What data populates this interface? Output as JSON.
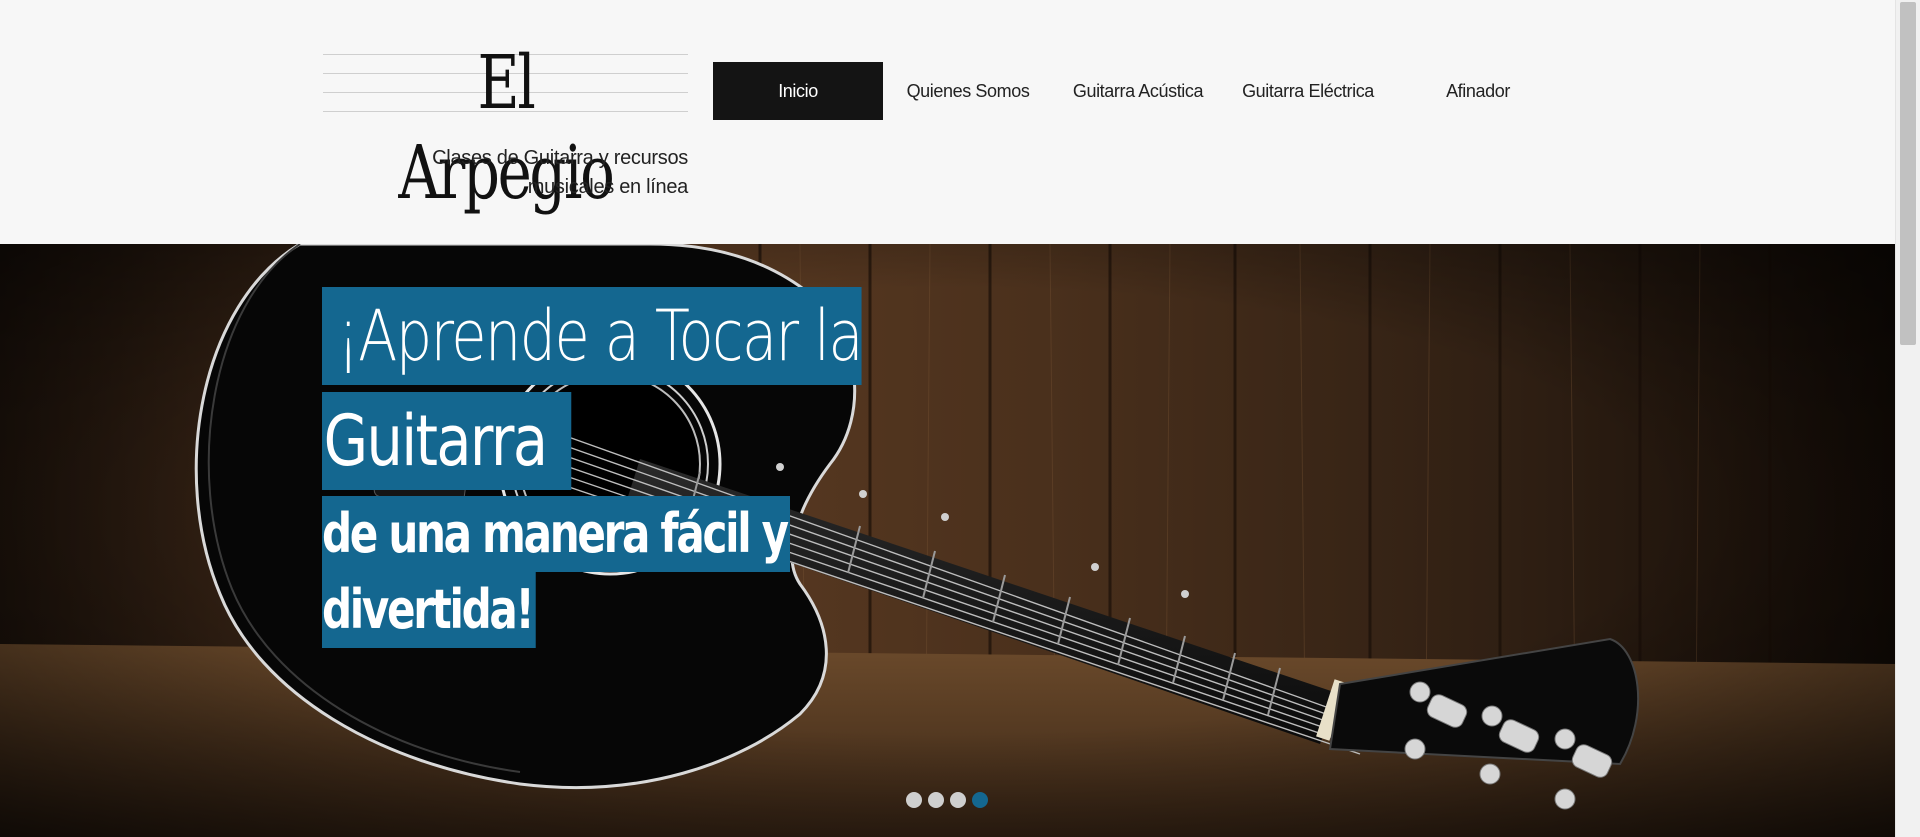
{
  "site": {
    "title": "El Arpegio",
    "tagline_line1": "Clases de Guitarra y recursos",
    "tagline_line2": "musicales en línea"
  },
  "nav": {
    "items": [
      {
        "label": "Inicio",
        "active": true
      },
      {
        "label": "Quienes Somos",
        "active": false
      },
      {
        "label": "Guitarra Acústica",
        "active": false
      },
      {
        "label": "Guitarra Eléctrica",
        "active": false
      },
      {
        "label": "Afinador",
        "active": false
      }
    ]
  },
  "hero": {
    "line1": "¡Aprende a Tocar la",
    "line2": "Guitarra",
    "line3": "de una manera fácil y",
    "line4": "divertida!",
    "image": "acoustic-guitar-on-wood-background",
    "slides_total": 4,
    "active_slide": 4
  },
  "colors": {
    "accent": "#146790",
    "nav_active_bg": "#141414",
    "header_bg": "#f7f7f7"
  }
}
